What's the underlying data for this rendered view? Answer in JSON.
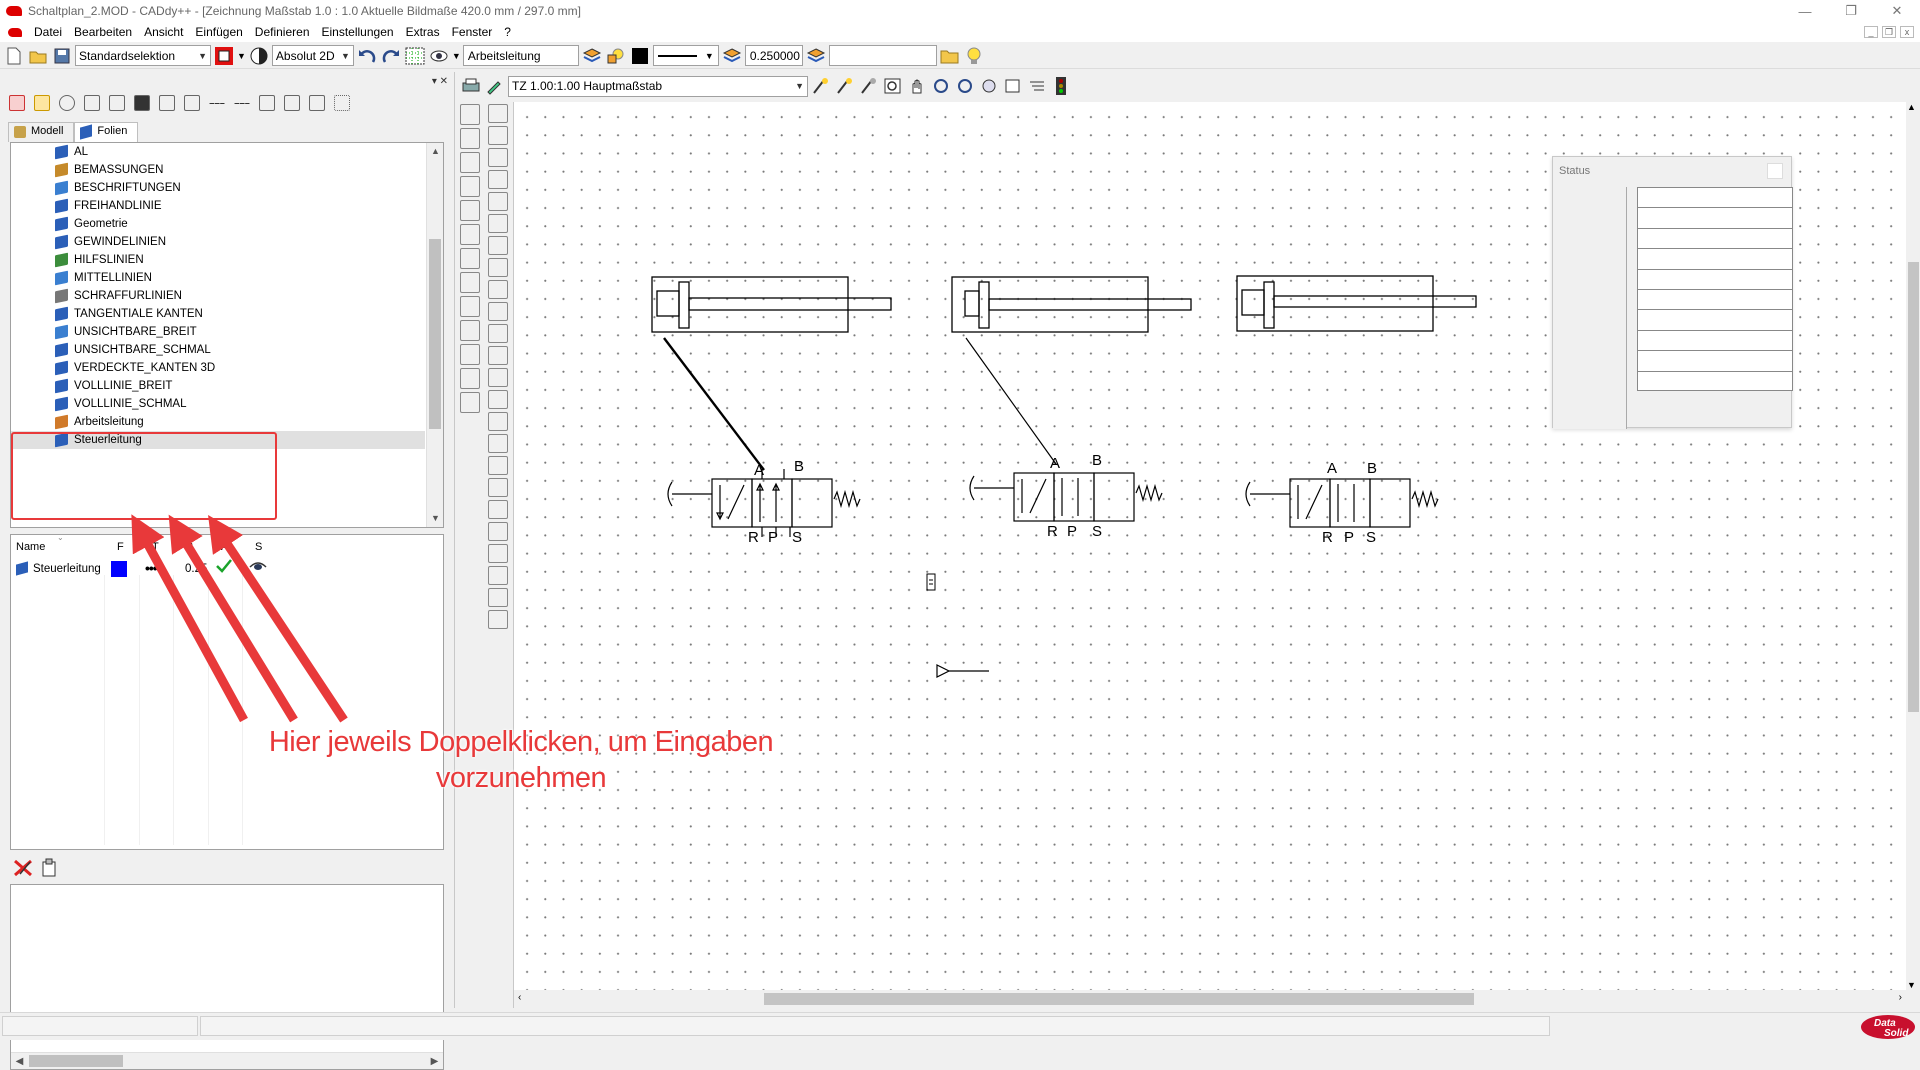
{
  "window": {
    "title": "Schaltplan_2.MOD  -  CADdy++ - [Zeichnung   Maßstab 1.0 : 1.0   Aktuelle Bildmaße 420.0 mm / 297.0 mm]"
  },
  "menu": {
    "items": [
      "Datei",
      "Bearbeiten",
      "Ansicht",
      "Einfügen",
      "Definieren",
      "Einstellungen",
      "Extras",
      "Fenster",
      "?"
    ]
  },
  "toolbar": {
    "selection_mode": "Standardselektion",
    "coord_mode": "Absolut 2D",
    "layer_name": "Arbeitsleitung",
    "line_width": "0.250000",
    "search_value": ""
  },
  "view_toolbar": {
    "scale": "TZ 1.00:1.00 Hauptmaßstab"
  },
  "tabs": [
    "Modell",
    "Folien"
  ],
  "layers": [
    {
      "name": "AL",
      "color": "#2b5fb8"
    },
    {
      "name": "BEMASSUNGEN",
      "color": "#c58a2a"
    },
    {
      "name": "BESCHRIFTUNGEN",
      "color": "#3a7fd0"
    },
    {
      "name": "FREIHANDLINIE",
      "color": "#2b5fb8"
    },
    {
      "name": "Geometrie",
      "color": "#2b5fb8"
    },
    {
      "name": "GEWINDELINIEN",
      "color": "#2b5fb8"
    },
    {
      "name": "HILFSLINIEN",
      "color": "#3c8d3c"
    },
    {
      "name": "MITTELLINIEN",
      "color": "#3a7fd0"
    },
    {
      "name": "SCHRAFFURLINIEN",
      "color": "#777777"
    },
    {
      "name": "TANGENTIALE KANTEN",
      "color": "#2b5fb8"
    },
    {
      "name": "UNSICHTBARE_BREIT",
      "color": "#3a7fd0"
    },
    {
      "name": "UNSICHTBARE_SCHMAL",
      "color": "#2b5fb8"
    },
    {
      "name": "VERDECKTE_KANTEN 3D",
      "color": "#2b5fb8"
    },
    {
      "name": "VOLLLINIE_BREIT",
      "color": "#2b5fb8"
    },
    {
      "name": "VOLLLINIE_SCHMAL",
      "color": "#2b5fb8"
    },
    {
      "name": "Arbeitsleitung",
      "color": "#d07a2a"
    },
    {
      "name": "Steuerleitung",
      "color": "#2b5fb8"
    }
  ],
  "properties": {
    "headers": {
      "name": "Name",
      "f": "F",
      "t": "T",
      "b": "B",
      "a": "A",
      "s": "S"
    },
    "row": {
      "name": "Steuerleitung",
      "color": "#0000ff",
      "width": "0.25"
    }
  },
  "status_window": {
    "title": "Status"
  },
  "drawing": {
    "port_labels": {
      "a": "A",
      "b": "B",
      "r": "R",
      "p": "P",
      "s": "S"
    }
  },
  "annotation": {
    "line1": "Hier jeweils Doppelklicken, um Eingaben",
    "line2": "vorzunehmen",
    "color": "#e8393a"
  },
  "logo": {
    "line1": "Data",
    "line2": "Solid"
  }
}
